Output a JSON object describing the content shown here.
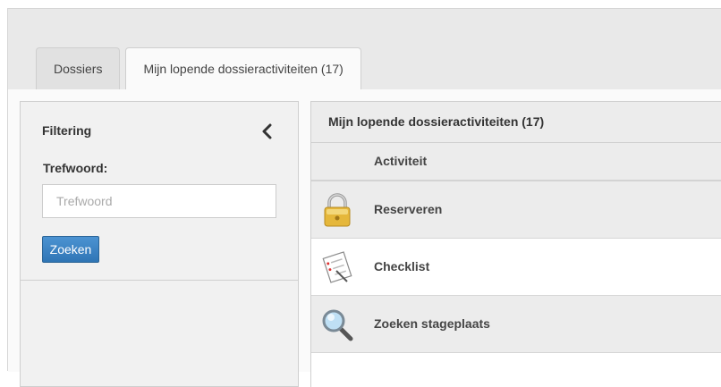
{
  "tabs": [
    {
      "label": "Dossiers",
      "active": false
    },
    {
      "label": "Mijn lopende dossieractiviteiten (17)",
      "active": true
    }
  ],
  "filter": {
    "title": "Filtering",
    "keyword_label": "Trefwoord:",
    "keyword_placeholder": "Trefwoord",
    "keyword_value": "",
    "search_button": "Zoeken"
  },
  "activities": {
    "title": "Mijn lopende dossieractiviteiten (17)",
    "column_header": "Activiteit",
    "rows": [
      {
        "label": "Reserveren",
        "icon": "lock-icon"
      },
      {
        "label": "Checklist",
        "icon": "checklist-icon"
      },
      {
        "label": "Zoeken stageplaats",
        "icon": "magnifier-icon"
      }
    ]
  },
  "colors": {
    "accent": "#337ab7",
    "panel_background": "#ececec",
    "page_background": "#e9e9e9"
  }
}
